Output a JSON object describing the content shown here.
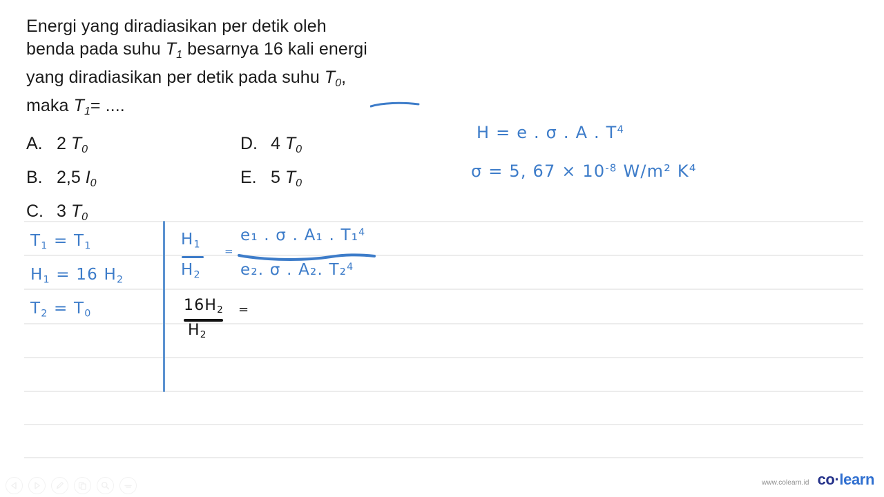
{
  "question": {
    "lines": [
      "Energi yang diradiasikan per detik oleh",
      "benda pada suhu T1 besarnya 16 kali energi",
      "yang diradiasikan per detik pada suhu T0,",
      "maka T1= ...."
    ],
    "line1": "Energi yang diradiasikan per detik oleh",
    "line2_a": "benda pada suhu ",
    "line2_var": "T",
    "line2_sub": "1",
    "line2_b": " besarnya 16 kali energi",
    "line3_a": "yang diradiasikan per detik pada suhu ",
    "line3_var": "T",
    "line3_sub": "0",
    "line3_b": ",",
    "line4_a": "maka ",
    "line4_var": "T",
    "line4_sub": "1",
    "line4_b": "= ...."
  },
  "choices": {
    "left": [
      {
        "letter": "A.",
        "coef": "2",
        "unit": "T",
        "sub": "0"
      },
      {
        "letter": "B.",
        "coef": "2,5",
        "unit": "I",
        "sub": "0"
      },
      {
        "letter": "C.",
        "coef": "3",
        "unit": "T",
        "sub": "0"
      }
    ],
    "right": [
      {
        "letter": "D.",
        "coef": "4",
        "unit": "T",
        "sub": "0"
      },
      {
        "letter": "E.",
        "coef": "5",
        "unit": "T",
        "sub": "0"
      }
    ]
  },
  "handwriting": {
    "formula_H": {
      "text": "H = e . σ . A . T",
      "sup": "4"
    },
    "formula_sigma": {
      "text": "σ = 5, 67 × 10",
      "sup": "-8",
      "units": "W/m² K⁴"
    },
    "givens": [
      {
        "lhs": "T",
        "lhs_sub": "1",
        "eq": " = ",
        "rhs": "T",
        "rhs_sub": "1"
      },
      {
        "lhs": "H",
        "lhs_sub": "1",
        "eq": " = 16 ",
        "rhs": "H",
        "rhs_sub": "2"
      },
      {
        "lhs": "T",
        "lhs_sub": "2",
        "eq": " = ",
        "rhs": "T",
        "rhs_sub": "0"
      }
    ],
    "ratio": {
      "lhs_num": "H",
      "lhs_num_sub": "1",
      "lhs_den": "H",
      "lhs_den_sub": "2",
      "equals": "=",
      "rhs_num": "e₁ . σ . A₁ . T₁",
      "rhs_num_sup": "4",
      "rhs_den": "e₂. σ . A₂. T₂",
      "rhs_den_sup": "4"
    },
    "substitution": {
      "num": "16H",
      "num_sub": "2",
      "den": "H",
      "den_sub": "2",
      "equals": "="
    }
  },
  "toolbar": {
    "items": [
      {
        "name": "prev-page-button",
        "icon": "triangle-left-icon"
      },
      {
        "name": "next-page-button",
        "icon": "triangle-right-icon"
      },
      {
        "name": "pen-tool-button",
        "icon": "pen-icon"
      },
      {
        "name": "copy-button",
        "icon": "copy-icon"
      },
      {
        "name": "zoom-search-button",
        "icon": "magnifier-icon"
      },
      {
        "name": "more-options-button",
        "icon": "ellipsis-icon"
      }
    ]
  },
  "logo": {
    "url": "www.colearn.id",
    "co": "co",
    "dot": "·",
    "learn": "learn"
  },
  "colors": {
    "ink_blue": "#3d7cc9",
    "ink_black": "#121212",
    "rule_gray": "#ececec",
    "logo_navy": "#27348b",
    "logo_blue": "#2f6fd0"
  }
}
